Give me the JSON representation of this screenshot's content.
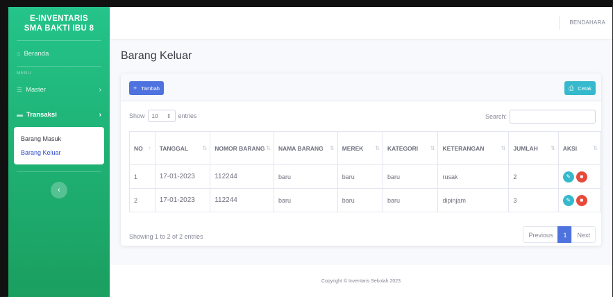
{
  "brand": {
    "line1": "E-INVENTARIS",
    "line2": "SMA BAKTI IBU 8"
  },
  "sidebar": {
    "home": {
      "icon": "home-icon",
      "label": "Beranda"
    },
    "menu_heading": "MENU",
    "master": {
      "icon": "list-icon",
      "label": "Master"
    },
    "transaksi": {
      "icon": "folder-icon",
      "label": "Transaksi"
    },
    "submenu": [
      "Barang Masuk",
      "Barang Keluar"
    ]
  },
  "topbar": {
    "user": "BENDAHARA"
  },
  "page": {
    "title": "Barang Keluar"
  },
  "toolbar": {
    "add_label": "Tambah",
    "print_label": "Cetak"
  },
  "table_controls": {
    "show": "Show",
    "entries_value": "10",
    "entries": "entries",
    "search_label": "Search:"
  },
  "table": {
    "headers": [
      "NO",
      "TANGGAL",
      "NOMOR BARANG",
      "NAMA BARANG",
      "MEREK",
      "KATEGORI",
      "KETERANGAN",
      "JUMLAH",
      "AKSI"
    ],
    "rows": [
      [
        "1",
        "17-01-2023",
        "112244",
        "baru",
        "baru",
        "baru",
        "rusak",
        "2"
      ],
      [
        "2",
        "17-01-2023",
        "112244",
        "baru",
        "baru",
        "baru",
        "dipinjam",
        "3"
      ]
    ]
  },
  "pagination": {
    "info": "Showing 1 to 2 of 2 entries",
    "previous": "Previous",
    "current": "1",
    "next": "Next"
  },
  "footer": {
    "text": "Copyright © Inventaris Sekolah 2023"
  },
  "colors": {
    "sidebar": "#1cc88a",
    "primary": "#4e73df",
    "info": "#36b9cc",
    "danger": "#e74a3b"
  }
}
